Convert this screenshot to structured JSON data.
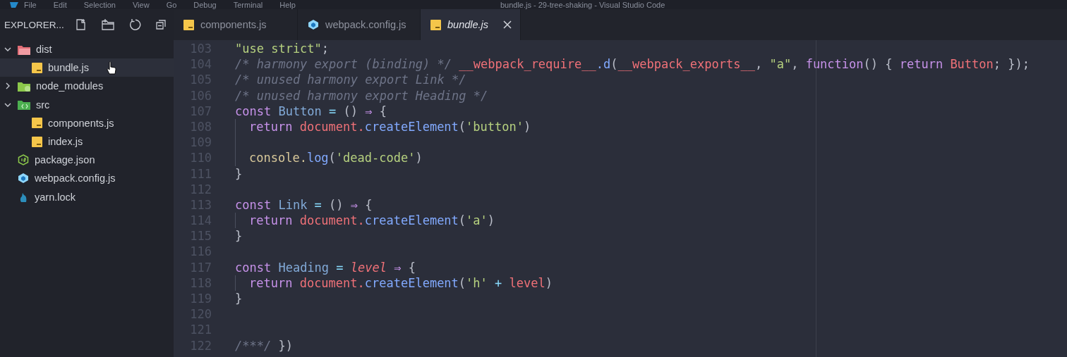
{
  "window": {
    "title": "bundle.js - 29-tree-shaking - Visual Studio Code"
  },
  "menu": [
    "File",
    "Edit",
    "Selection",
    "View",
    "Go",
    "Debug",
    "Terminal",
    "Help"
  ],
  "sidebar": {
    "title": "EXPLORER...",
    "tree": [
      {
        "label": "dist",
        "kind": "folder-dist",
        "expanded": true,
        "selected": false,
        "children": [
          {
            "label": "bundle.js",
            "kind": "js",
            "selected": true
          }
        ]
      },
      {
        "label": "node_modules",
        "kind": "folder-node",
        "expanded": false,
        "selected": false
      },
      {
        "label": "src",
        "kind": "folder-src",
        "expanded": true,
        "selected": false,
        "children": [
          {
            "label": "components.js",
            "kind": "js",
            "selected": false
          },
          {
            "label": "index.js",
            "kind": "js",
            "selected": false
          }
        ]
      },
      {
        "label": "package.json",
        "kind": "json",
        "selected": false
      },
      {
        "label": "webpack.config.js",
        "kind": "webpack",
        "selected": false
      },
      {
        "label": "yarn.lock",
        "kind": "yarn",
        "selected": false
      }
    ]
  },
  "tabs": [
    {
      "label": "components.js",
      "kind": "js",
      "selected": false,
      "preview": false
    },
    {
      "label": "webpack.config.js",
      "kind": "webpack",
      "selected": false,
      "preview": false
    },
    {
      "label": "bundle.js",
      "kind": "js",
      "selected": true,
      "preview": true
    }
  ],
  "editor": {
    "lines": [
      {
        "number": "103",
        "indented": false,
        "tokens": [
          {
            "kind": "str",
            "text": "\"use strict\""
          },
          {
            "kind": "punc",
            "text": ";"
          }
        ]
      },
      {
        "number": "104",
        "indented": false,
        "tokens": [
          {
            "kind": "comment",
            "text": "/* harmony export (binding) */ "
          },
          {
            "kind": "var",
            "text": "__webpack_require__"
          },
          {
            "kind": "method",
            "text": ".d"
          },
          {
            "kind": "punc",
            "text": "("
          },
          {
            "kind": "var",
            "text": "__webpack_exports__"
          },
          {
            "kind": "punc",
            "text": ", "
          },
          {
            "kind": "str",
            "text": "\"a\""
          },
          {
            "kind": "punc",
            "text": ", "
          },
          {
            "kind": "kw",
            "text": "function"
          },
          {
            "kind": "punc",
            "text": "() { "
          },
          {
            "kind": "kw",
            "text": "return "
          },
          {
            "kind": "var",
            "text": "Button"
          },
          {
            "kind": "punc",
            "text": "; });"
          }
        ]
      },
      {
        "number": "105",
        "indented": false,
        "tokens": [
          {
            "kind": "comment",
            "text": "/* unused harmony export Link */"
          }
        ]
      },
      {
        "number": "106",
        "indented": false,
        "tokens": [
          {
            "kind": "comment",
            "text": "/* unused harmony export Heading */"
          }
        ]
      },
      {
        "number": "107",
        "indented": false,
        "tokens": [
          {
            "kind": "kw",
            "text": "const "
          },
          {
            "kind": "def",
            "text": "Button"
          },
          {
            "kind": "op",
            "text": " = "
          },
          {
            "kind": "punc",
            "text": "() "
          },
          {
            "kind": "kw",
            "text": "⇒"
          },
          {
            "kind": "punc",
            "text": " {"
          }
        ]
      },
      {
        "number": "108",
        "indented": true,
        "tokens": [
          {
            "kind": "kw",
            "text": "return "
          },
          {
            "kind": "var",
            "text": "document."
          },
          {
            "kind": "method",
            "text": "createElement"
          },
          {
            "kind": "punc",
            "text": "("
          },
          {
            "kind": "str",
            "text": "'button'"
          },
          {
            "kind": "punc",
            "text": ")"
          }
        ]
      },
      {
        "number": "109",
        "indented": true
      },
      {
        "number": "110",
        "indented": true,
        "tokens": [
          {
            "kind": "obj",
            "text": "console."
          },
          {
            "kind": "method",
            "text": "log"
          },
          {
            "kind": "punc",
            "text": "("
          },
          {
            "kind": "str",
            "text": "'dead-code'"
          },
          {
            "kind": "punc",
            "text": ")"
          }
        ]
      },
      {
        "number": "111",
        "indented": false,
        "tokens": [
          {
            "kind": "punc",
            "text": "}"
          }
        ]
      },
      {
        "number": "112",
        "indented": false
      },
      {
        "number": "113",
        "indented": false,
        "tokens": [
          {
            "kind": "kw",
            "text": "const "
          },
          {
            "kind": "def",
            "text": "Link"
          },
          {
            "kind": "op",
            "text": " = "
          },
          {
            "kind": "punc",
            "text": "() "
          },
          {
            "kind": "kw",
            "text": "⇒"
          },
          {
            "kind": "punc",
            "text": " {"
          }
        ]
      },
      {
        "number": "114",
        "indented": true,
        "tokens": [
          {
            "kind": "kw",
            "text": "return "
          },
          {
            "kind": "var",
            "text": "document."
          },
          {
            "kind": "method",
            "text": "createElement"
          },
          {
            "kind": "punc",
            "text": "("
          },
          {
            "kind": "str",
            "text": "'a'"
          },
          {
            "kind": "punc",
            "text": ")"
          }
        ]
      },
      {
        "number": "115",
        "indented": false,
        "tokens": [
          {
            "kind": "punc",
            "text": "}"
          }
        ]
      },
      {
        "number": "116",
        "indented": false
      },
      {
        "number": "117",
        "indented": false,
        "tokens": [
          {
            "kind": "kw",
            "text": "const "
          },
          {
            "kind": "def",
            "text": "Heading"
          },
          {
            "kind": "op",
            "text": " = "
          },
          {
            "kind": "param",
            "text": "level"
          },
          {
            "kind": "kw",
            "text": " ⇒"
          },
          {
            "kind": "punc",
            "text": " {"
          }
        ]
      },
      {
        "number": "118",
        "indented": true,
        "tokens": [
          {
            "kind": "kw",
            "text": "return "
          },
          {
            "kind": "var",
            "text": "document."
          },
          {
            "kind": "method",
            "text": "createElement"
          },
          {
            "kind": "punc",
            "text": "("
          },
          {
            "kind": "str",
            "text": "'h'"
          },
          {
            "kind": "op",
            "text": " + "
          },
          {
            "kind": "var",
            "text": "level"
          },
          {
            "kind": "punc",
            "text": ")"
          }
        ]
      },
      {
        "number": "119",
        "indented": false,
        "tokens": [
          {
            "kind": "punc",
            "text": "}"
          }
        ]
      },
      {
        "number": "120",
        "indented": false
      },
      {
        "number": "121",
        "indented": false
      },
      {
        "number": "122",
        "indented": false,
        "tokens": [
          {
            "kind": "comment",
            "text": "/***/ "
          },
          {
            "kind": "punc",
            "text": "})"
          }
        ]
      }
    ]
  }
}
